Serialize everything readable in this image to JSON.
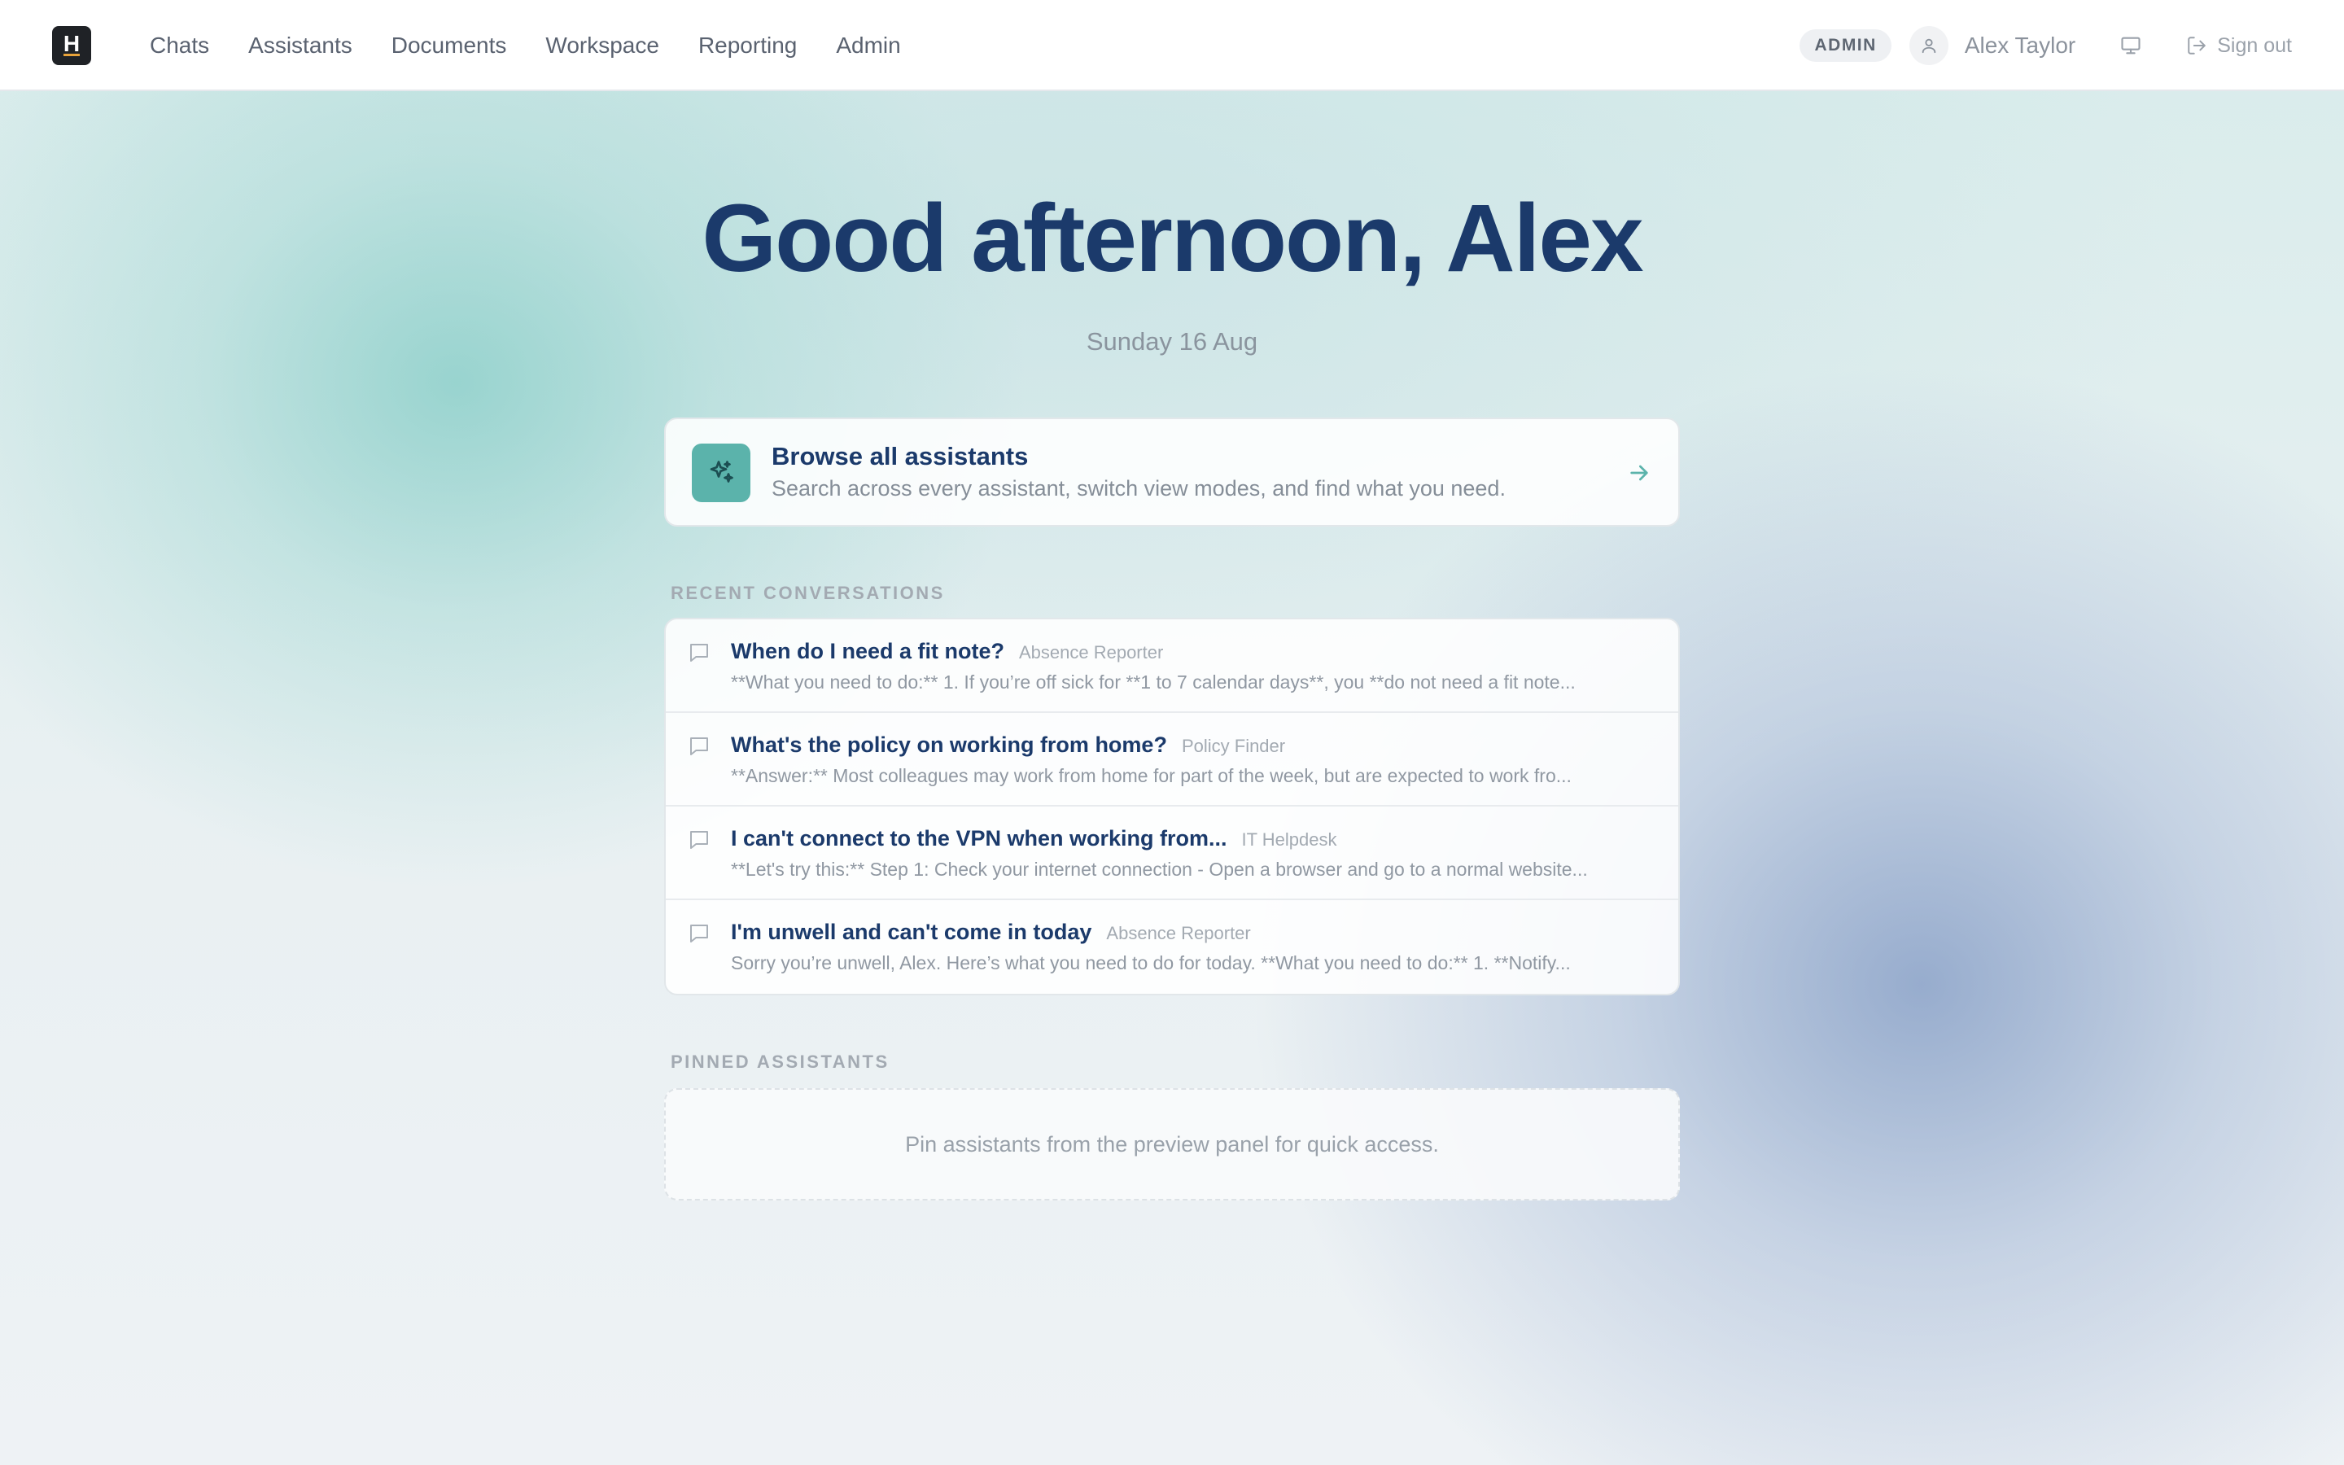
{
  "brand": {
    "logo_letter": "H"
  },
  "nav": {
    "items": [
      {
        "label": "Chats"
      },
      {
        "label": "Assistants"
      },
      {
        "label": "Documents"
      },
      {
        "label": "Workspace"
      },
      {
        "label": "Reporting"
      },
      {
        "label": "Admin"
      }
    ]
  },
  "user": {
    "role_badge": "ADMIN",
    "name": "Alex Taylor",
    "sign_out_label": "Sign out"
  },
  "hero": {
    "greeting": "Good afternoon, Alex",
    "date": "Sunday 16 Aug"
  },
  "browse": {
    "title": "Browse all assistants",
    "subtitle": "Search across every assistant, switch view modes, and find what you need."
  },
  "recent": {
    "label": "RECENT CONVERSATIONS",
    "items": [
      {
        "title": "When do I need a fit note?",
        "assistant": "Absence Reporter",
        "preview": "**What you need to do:** 1. If you’re off sick for **1 to 7 calendar days**, you **do not need a fit note..."
      },
      {
        "title": "What's the policy on working from home?",
        "assistant": "Policy Finder",
        "preview": "**Answer:** Most colleagues may work from home for part of the week, but are expected to work fro..."
      },
      {
        "title": "I can't connect to the VPN when working from...",
        "assistant": "IT Helpdesk",
        "preview": "**Let's try this:** Step 1: Check your internet connection - Open a browser and go to a normal website..."
      },
      {
        "title": "I'm unwell and can't come in today",
        "assistant": "Absence Reporter",
        "preview": "Sorry you’re unwell, Alex. Here’s what you need to do for today. **What you need to do:** 1. **Notify..."
      }
    ]
  },
  "pinned": {
    "label": "PINNED ASSISTANTS",
    "empty_text": "Pin assistants from the preview panel for quick access."
  },
  "colors": {
    "accent": "#5bb3ab",
    "heading": "#1b3a6b",
    "logo_bg": "#1f2226",
    "logo_accent": "#e8a33a"
  }
}
